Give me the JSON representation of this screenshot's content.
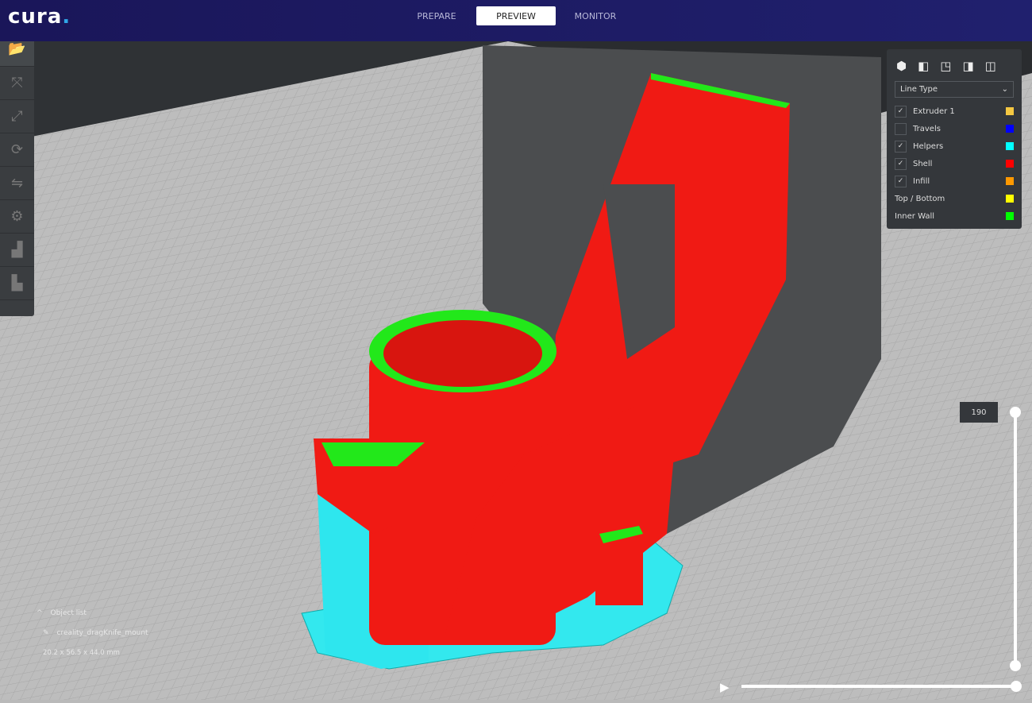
{
  "app": {
    "logo": "cura",
    "tabs": [
      "PREPARE",
      "PREVIEW",
      "MONITOR"
    ],
    "active_tab": "PREVIEW"
  },
  "toolbar": {
    "items": [
      "open-file",
      "move",
      "scale",
      "rotate",
      "mirror",
      "per-model-settings",
      "support-blocker",
      "layers"
    ]
  },
  "view_panel": {
    "view_buttons": [
      "3d-view",
      "front-view",
      "top-view",
      "left-view",
      "right-view"
    ],
    "color_scheme": "Line Type",
    "checkbox_items": [
      {
        "label": "Extruder 1",
        "checked": true,
        "color": "#f5c842"
      },
      {
        "label": "Travels",
        "checked": false,
        "color": "#0000ff"
      },
      {
        "label": "Helpers",
        "checked": true,
        "color": "#00ffff"
      },
      {
        "label": "Shell",
        "checked": true,
        "color": "#ff0000"
      },
      {
        "label": "Infill",
        "checked": true,
        "color": "#ff9900"
      }
    ],
    "legend_items": [
      {
        "label": "Top / Bottom",
        "color": "#ffff00"
      },
      {
        "label": "Inner Wall",
        "color": "#00ff00"
      }
    ]
  },
  "object_info": {
    "list_label": "Object list",
    "name": "creality_dragKnife_mount",
    "dimensions": "20.2 x 56.5 x 44.0 mm"
  },
  "layer_slider": {
    "current_layer": "190",
    "value_fraction": 1.0
  },
  "playback": {
    "progress_fraction": 1.0
  }
}
